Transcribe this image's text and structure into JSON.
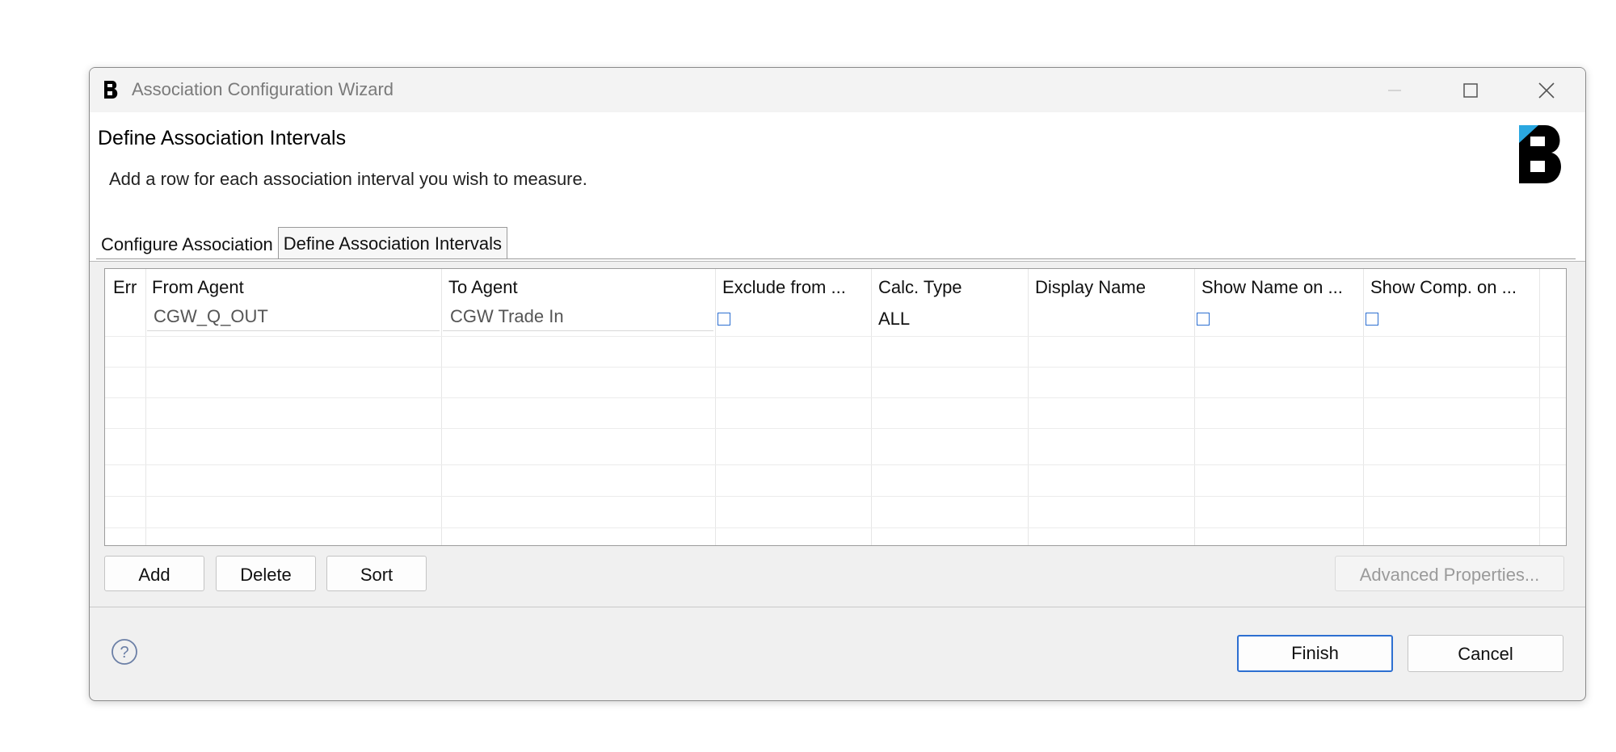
{
  "window": {
    "title": "Association Configuration Wizard"
  },
  "header": {
    "title": "Define Association Intervals",
    "description": "Add a row for each association interval you wish to measure."
  },
  "tabs": [
    {
      "label": "Configure Association",
      "active": false
    },
    {
      "label": "Define Association Intervals",
      "active": true
    }
  ],
  "table": {
    "columns": [
      "Err",
      "From Agent",
      "To Agent",
      "Exclude from ...",
      "Calc. Type",
      "Display Name",
      "Show Name on ...",
      "Show Comp. on ..."
    ],
    "rows": [
      {
        "err": "",
        "from_agent": "CGW_Q_OUT",
        "to_agent": "CGW Trade In",
        "exclude": false,
        "calc_type": "ALL",
        "display_name": "",
        "show_name": false,
        "show_comp": false
      }
    ]
  },
  "table_buttons": {
    "add": "Add",
    "delete": "Delete",
    "sort": "Sort",
    "advanced": "Advanced Properties..."
  },
  "footer": {
    "finish": "Finish",
    "cancel": "Cancel"
  },
  "icons": {
    "app": "brand-b-icon",
    "help": "help-icon",
    "minimize": "minimize-icon",
    "maximize": "maximize-icon",
    "close": "close-icon"
  },
  "colors": {
    "accent": "#2d6fd1",
    "logo_blue": "#2aa7e0"
  }
}
